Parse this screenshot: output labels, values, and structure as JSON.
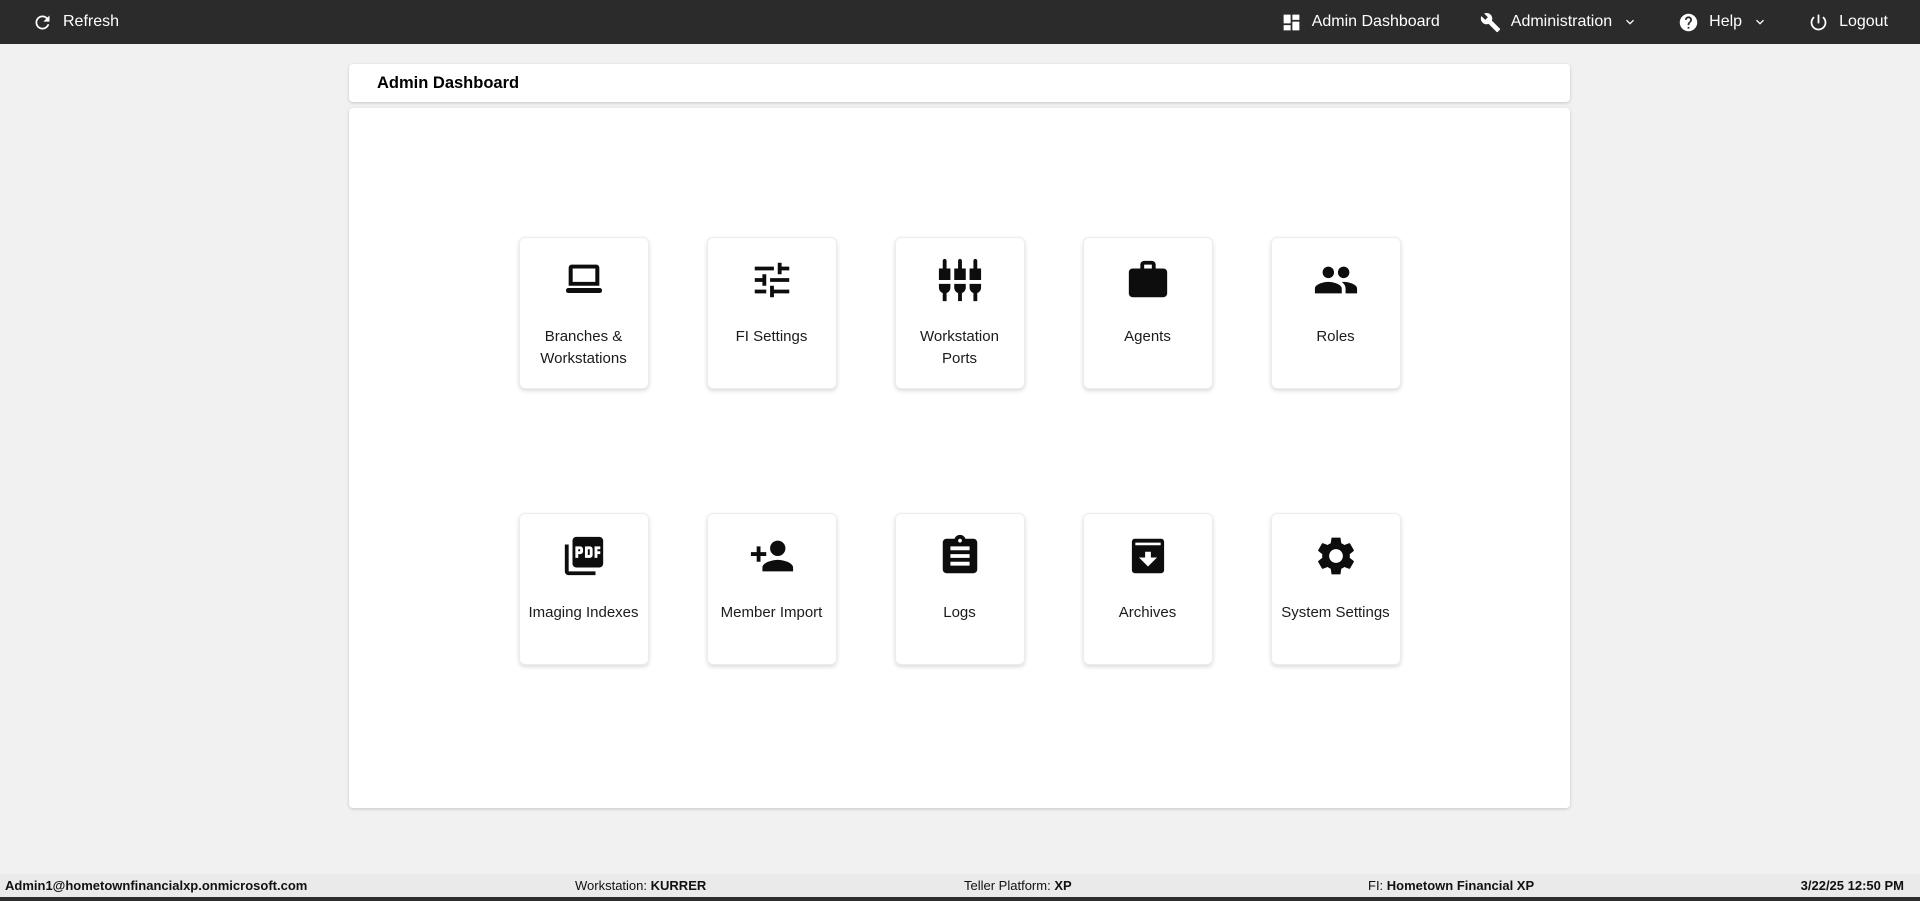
{
  "topbar": {
    "refresh_label": "Refresh",
    "nav": [
      {
        "label": "Admin Dashboard",
        "icon": "dashboard-icon",
        "caret": false
      },
      {
        "label": "Administration",
        "icon": "wrench-icon",
        "caret": true
      },
      {
        "label": "Help",
        "icon": "help-icon",
        "caret": true
      },
      {
        "label": "Logout",
        "icon": "power-icon",
        "caret": false
      }
    ]
  },
  "page": {
    "title": "Admin Dashboard"
  },
  "tiles": [
    {
      "label": "Branches & Workstations",
      "icon": "laptop-icon"
    },
    {
      "label": "FI Settings",
      "icon": "sliders-icon"
    },
    {
      "label": "Workstation Ports",
      "icon": "ports-icon"
    },
    {
      "label": "Agents",
      "icon": "briefcase-icon"
    },
    {
      "label": "Roles",
      "icon": "people-icon"
    },
    {
      "label": "Imaging Indexes",
      "icon": "pdf-icon"
    },
    {
      "label": "Member Import",
      "icon": "person-add-icon"
    },
    {
      "label": "Logs",
      "icon": "clipboard-icon"
    },
    {
      "label": "Archives",
      "icon": "archive-icon"
    },
    {
      "label": "System Settings",
      "icon": "gear-icon"
    }
  ],
  "statusbar": {
    "user": "Admin1@hometownfinancialxp.onmicrosoft.com",
    "workstation_label": "Workstation:",
    "workstation_value": "KURRER",
    "platform_label": "Teller Platform:",
    "platform_value": "XP",
    "fi_label": "FI:",
    "fi_value": "Hometown Financial XP",
    "timestamp": "3/22/25 12:50 PM"
  },
  "colors": {
    "topbar_bg": "#2b2b2b",
    "page_bg": "#f1f1f1",
    "card_bg": "#ffffff",
    "statusbar_bg": "#eaeaea",
    "bottom_strip": "#2e2e2e",
    "icon_color": "#0d0d0d",
    "topbar_text": "#ffffff"
  }
}
